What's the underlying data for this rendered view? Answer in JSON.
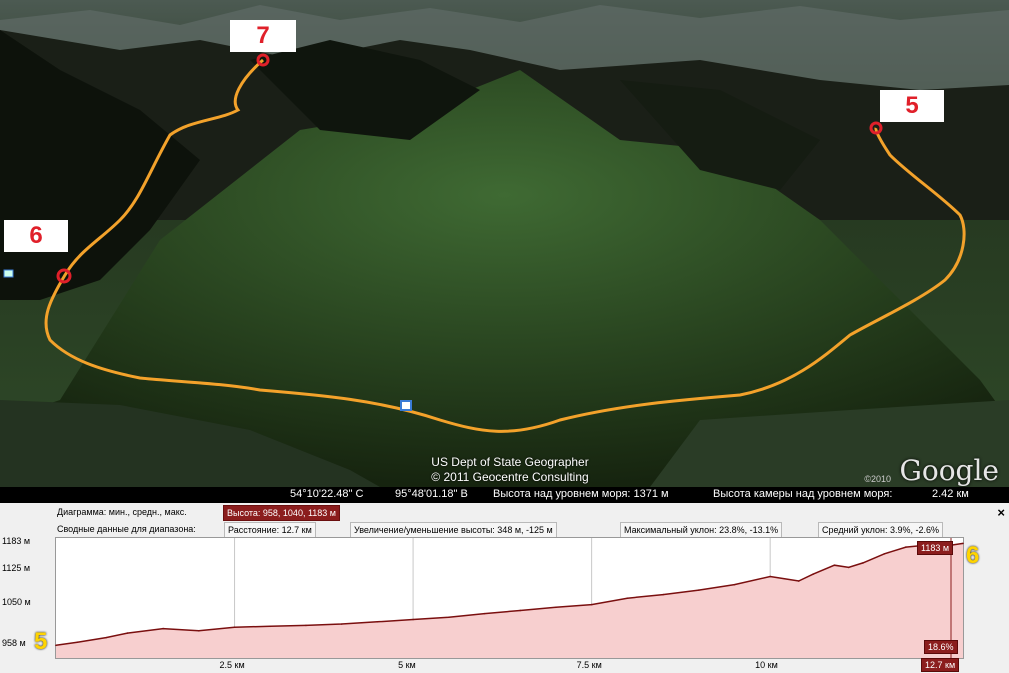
{
  "map_labels": {
    "p7": "7",
    "p5": "5",
    "p6": "6"
  },
  "credits": {
    "line1": "US Dept of State Geographer",
    "line2": "© 2011 Geocentre Consulting",
    "year": "©2010",
    "logo": "Google"
  },
  "status": {
    "lat": "54°10'22.48\" С",
    "lon": "95°48'01.18\" В",
    "elevation": "Высота над уровнем моря:  1371 м",
    "eye_alt": "Высота камеры над уровнем моря:",
    "eye_alt_value": "2.42 км"
  },
  "profile": {
    "row1_label": "Диаграмма: мин., средн., макс.",
    "row1_value": "Высота: 958, 1040, 1183 м",
    "row2_label": "Сводные данные для диапазона:",
    "distance": "Расстояние: 12.7 км",
    "gain_loss": "Увеличение/уменьшение высоты: 348 м, -125 м",
    "max_slope": "Максимальный уклон: 23.8%, -13.1%",
    "avg_slope": "Средний уклон: 3.9%, -2.6%",
    "close": "×",
    "start_marker": "5",
    "end_marker": "6",
    "end_value": "1183 м",
    "slope_value": "18.6%",
    "end_distance": "12.7 км"
  },
  "chart_data": {
    "type": "area",
    "title": "",
    "xlabel": "",
    "ylabel": "",
    "xlim": [
      0,
      12.7
    ],
    "ylim": [
      930,
      1195
    ],
    "y_ticks": [
      "1183 м",
      "1125 м",
      "1050 м",
      "958 м"
    ],
    "y_tick_values": [
      1183,
      1125,
      1050,
      958
    ],
    "x_ticks": [
      "2.5 км",
      "5 км",
      "7.5 км",
      "10 км"
    ],
    "x_tick_values": [
      2.5,
      5,
      7.5,
      10
    ],
    "x": [
      0,
      0.3,
      0.7,
      1.0,
      1.5,
      2.0,
      2.5,
      3.0,
      3.5,
      4.0,
      4.5,
      5.0,
      5.5,
      6.0,
      6.5,
      7.0,
      7.5,
      8.0,
      8.5,
      9.0,
      9.5,
      10.0,
      10.2,
      10.4,
      10.6,
      10.9,
      11.1,
      11.3,
      11.6,
      11.9,
      12.1,
      12.4,
      12.7
    ],
    "values": [
      958,
      965,
      975,
      985,
      995,
      990,
      998,
      1000,
      1002,
      1005,
      1010,
      1015,
      1020,
      1028,
      1035,
      1042,
      1048,
      1062,
      1070,
      1080,
      1092,
      1110,
      1105,
      1100,
      1115,
      1135,
      1130,
      1140,
      1160,
      1175,
      1178,
      1176,
      1183
    ],
    "fill_color": "#f7cfcf",
    "line_color": "#7a0f0f"
  },
  "colors": {
    "route": "#f3a22b",
    "accent": "#8b1d1d"
  }
}
